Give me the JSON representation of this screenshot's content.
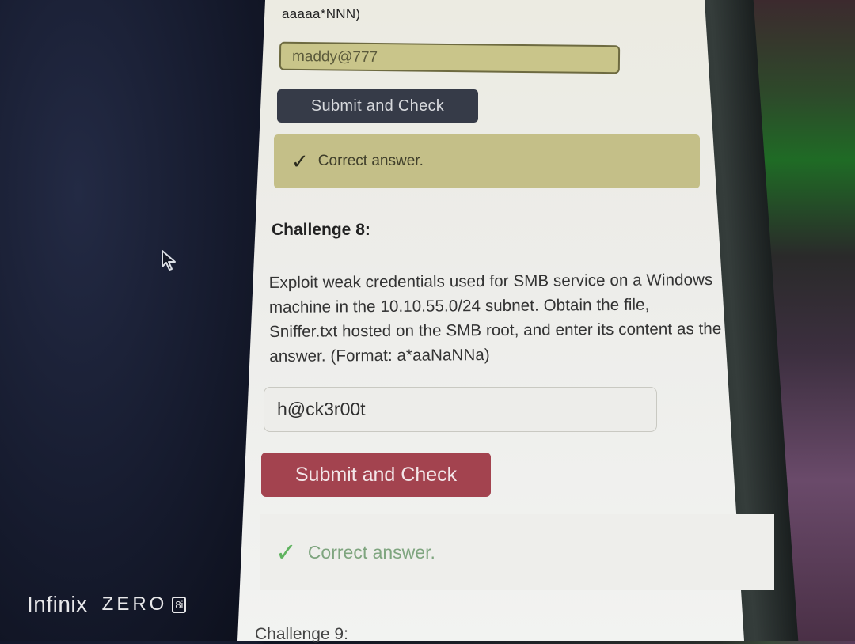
{
  "page": {
    "top_cut_text": "aaaaa*NNN)",
    "prev_answer_value": "maddy@777",
    "submit_label": "Submit and Check",
    "prev_result": "Correct answer.",
    "challenge_8": {
      "title": "Challenge 8:",
      "description": "Exploit weak credentials used for SMB service on a Windows machine in the 10.10.55.0/24 subnet. Obtain the file, Sniffer.txt hosted on the SMB root, and enter its content as the answer. (Format: a*aaNaNNa)",
      "answer_value": "h@ck3r00t",
      "submit_label": "Submit and Check",
      "result": "Correct answer."
    },
    "challenge_9_title": "Challenge 9:"
  },
  "watermark": {
    "brand": "Infinix",
    "model": "ZERO",
    "model_badge": "8i"
  },
  "icons": {
    "check": "check-icon",
    "cursor": "mouse-cursor-icon"
  },
  "colors": {
    "dark_button": "#363b48",
    "red_button": "#a3434f",
    "success_text": "#7fa57f",
    "success_check": "#5fb35f"
  }
}
